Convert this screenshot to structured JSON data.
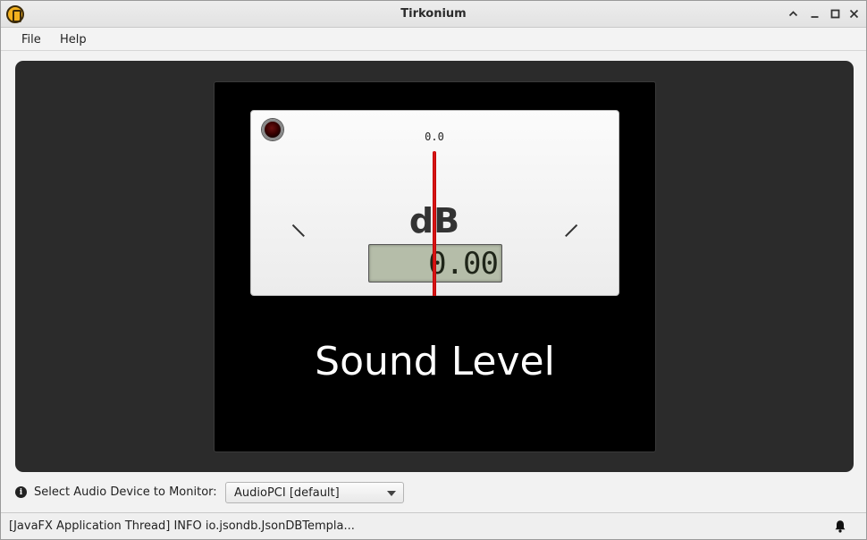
{
  "window": {
    "title": "Tirkonium",
    "controls": [
      "chevron-up-icon",
      "minimize-icon",
      "maximize-icon",
      "close-icon"
    ]
  },
  "menu": {
    "items": [
      "File",
      "Help"
    ]
  },
  "gauge": {
    "scale_top_label": "0.0",
    "unit": "dB",
    "lcd_value": "0.00",
    "title": "Sound Level",
    "needle_level": 0.0,
    "led_state": "off"
  },
  "device": {
    "label": "Select Audio Device to Monitor:",
    "selected": "AudioPCI [default]"
  },
  "status": {
    "text": "[JavaFX Application Thread] INFO io.jsondb.JsonDBTempla..."
  },
  "colors": {
    "panel": "#2b2b2b",
    "needle": "#d01010",
    "lcd": "#b5bda9"
  }
}
